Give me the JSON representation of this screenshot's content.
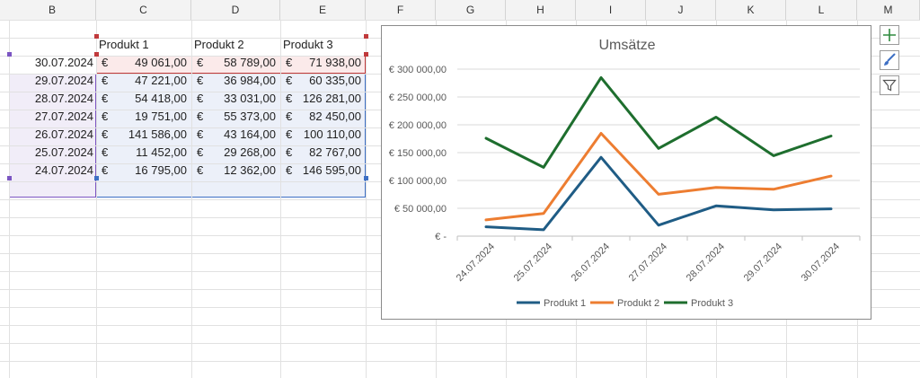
{
  "columns": [
    "B",
    "C",
    "D",
    "E",
    "F",
    "G",
    "H",
    "I",
    "J",
    "K",
    "L",
    "M"
  ],
  "table": {
    "headers": [
      "Produkt 1",
      "Produkt 2",
      "Produkt 3"
    ],
    "currency_symbol": "€",
    "rows": [
      {
        "date": "30.07.2024",
        "p1": "49 061,00",
        "p2": "58 789,00",
        "p3": "71 938,00"
      },
      {
        "date": "29.07.2024",
        "p1": "47 221,00",
        "p2": "36 984,00",
        "p3": "60 335,00"
      },
      {
        "date": "28.07.2024",
        "p1": "54 418,00",
        "p2": "33 031,00",
        "p3": "126 281,00"
      },
      {
        "date": "27.07.2024",
        "p1": "19 751,00",
        "p2": "55 373,00",
        "p3": "82 450,00"
      },
      {
        "date": "26.07.2024",
        "p1": "141 586,00",
        "p2": "43 164,00",
        "p3": "100 110,00"
      },
      {
        "date": "25.07.2024",
        "p1": "11 452,00",
        "p2": "29 268,00",
        "p3": "82 767,00"
      },
      {
        "date": "24.07.2024",
        "p1": "16 795,00",
        "p2": "12 362,00",
        "p3": "146 595,00"
      }
    ]
  },
  "chart_data": {
    "type": "line",
    "stacked": true,
    "title": "Umsätze",
    "categories": [
      "24.07.2024",
      "25.07.2024",
      "26.07.2024",
      "27.07.2024",
      "28.07.2024",
      "29.07.2024",
      "30.07.2024"
    ],
    "series": [
      {
        "name": "Produkt 1",
        "color": "#1f5c85",
        "values": [
          16795,
          11452,
          141586,
          19751,
          54418,
          47221,
          49061
        ]
      },
      {
        "name": "Produkt 2",
        "color": "#ed7d31",
        "values": [
          12362,
          29268,
          43164,
          55373,
          33031,
          36984,
          58789
        ]
      },
      {
        "name": "Produkt 3",
        "color": "#1e6e2e",
        "values": [
          146595,
          82767,
          100110,
          82450,
          126281,
          60335,
          71938
        ]
      }
    ],
    "ylim": [
      0,
      300000
    ],
    "ytick_labels": [
      "€ -",
      "€ 50 000,00",
      "€ 100 000,00",
      "€ 150 000,00",
      "€ 200 000,00",
      "€ 250 000,00",
      "€ 300 000,00"
    ],
    "grid": true,
    "legend": "bottom"
  },
  "side_buttons": [
    {
      "name": "chart-elements-button",
      "icon": "plus-icon"
    },
    {
      "name": "chart-styles-button",
      "icon": "brush-icon"
    },
    {
      "name": "chart-filters-button",
      "icon": "filter-icon"
    }
  ],
  "colors": {
    "selection_red": "#c0393b",
    "selection_blue": "#3d6fc4",
    "selection_purple": "#7b55c2"
  }
}
